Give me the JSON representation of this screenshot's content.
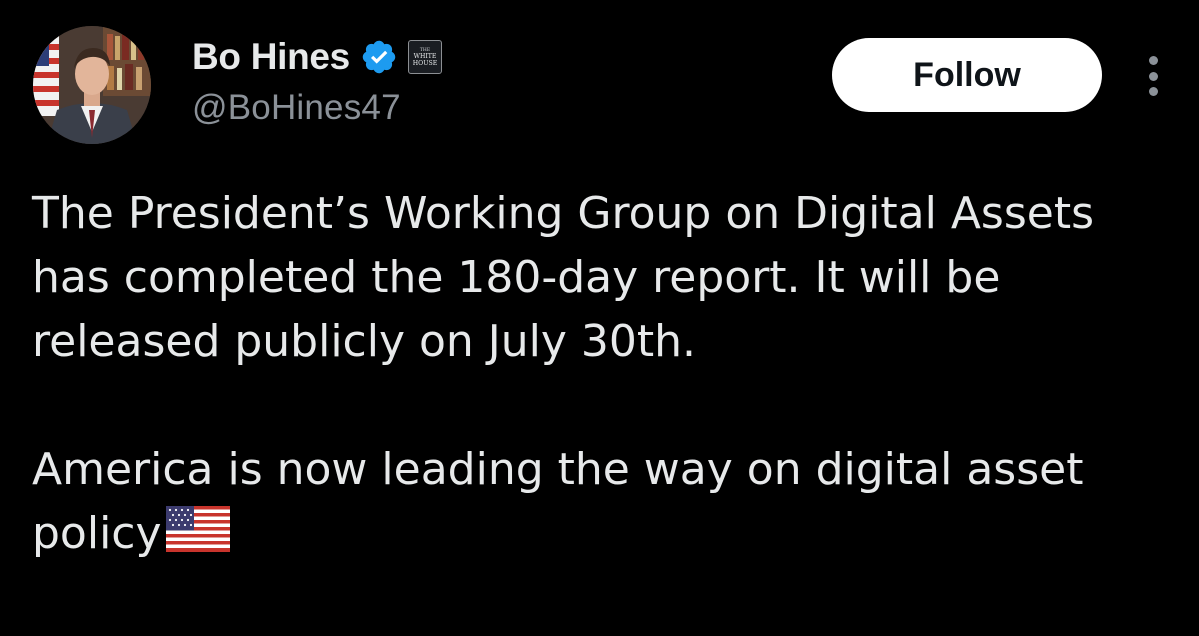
{
  "author": {
    "name": "Bo Hines",
    "handle": "@BoHines47",
    "verified": true,
    "affiliation_badge": "The White House",
    "affiliation_badge_lines": [
      "THE",
      "WHITE",
      "HOUSE"
    ],
    "avatar_icon": "profile-photo"
  },
  "actions": {
    "follow_label": "Follow",
    "more_icon": "more-vertical-icon"
  },
  "tweet": {
    "paragraph_1": "The President’s Working Group on Digital Assets has completed the 180-day report. It will be released publicly on July 30th.",
    "paragraph_2": "America is now leading the way on digital asset policy",
    "emoji": "us-flag-emoji"
  },
  "colors": {
    "background": "#000000",
    "text_primary": "#e7e9ea",
    "text_secondary": "#8b9198",
    "verified_blue": "#1d9bf0",
    "follow_bg": "#ffffff",
    "follow_text": "#0f1419"
  }
}
